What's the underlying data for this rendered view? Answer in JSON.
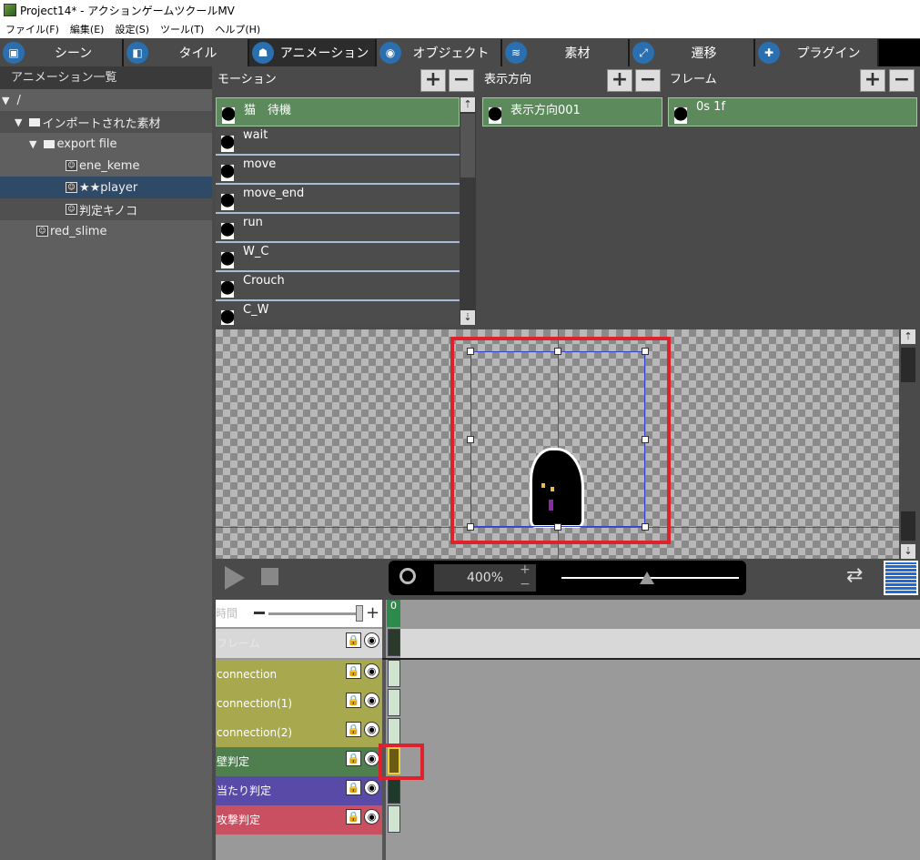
{
  "window": {
    "title": "Project14* - アクションゲームツクールMV"
  },
  "menu": [
    "ファイル(F)",
    "編集(E)",
    "設定(S)",
    "ツール(T)",
    "ヘルプ(H)"
  ],
  "tabs": [
    {
      "label": "シーン",
      "icon": "scene-icon"
    },
    {
      "label": "タイル",
      "icon": "tile-icon"
    },
    {
      "label": "アニメーション",
      "icon": "animation-icon"
    },
    {
      "label": "オブジェクト",
      "icon": "object-icon"
    },
    {
      "label": "素材",
      "icon": "material-icon"
    },
    {
      "label": "遷移",
      "icon": "transition-icon"
    },
    {
      "label": "プラグイン",
      "icon": "plugin-icon"
    }
  ],
  "tree": {
    "header": "アニメーション一覧",
    "items": [
      {
        "label": "/"
      },
      {
        "label": "インポートされた素材"
      },
      {
        "label": "export file"
      },
      {
        "label": "ene_keme"
      },
      {
        "label": "★★player"
      },
      {
        "label": "判定キノコ"
      },
      {
        "label": "red_slime"
      }
    ]
  },
  "motion": {
    "header": "モーション",
    "items": [
      "猫　待機",
      "wait",
      "move",
      "move_end",
      "run",
      "W_C",
      "Crouch",
      "C_W"
    ]
  },
  "direction": {
    "header": "表示方向",
    "items": [
      "表示方向001"
    ]
  },
  "frame": {
    "header": "フレーム",
    "items": [
      "0s 1f"
    ]
  },
  "zoom": {
    "value": "400%"
  },
  "timeline": {
    "time_label": "時間",
    "frame_col": "0",
    "layers": [
      {
        "name": "フレーム",
        "color": "#d8d8d8"
      },
      {
        "name": "connection",
        "color": "#a8a84e"
      },
      {
        "name": "connection(1)",
        "color": "#a8a84e"
      },
      {
        "name": "connection(2)",
        "color": "#a8a84e"
      },
      {
        "name": "壁判定",
        "color": "#4f7f4f"
      },
      {
        "name": "当たり判定",
        "color": "#5a4aa8"
      },
      {
        "name": "攻撃判定",
        "color": "#c85060"
      }
    ]
  }
}
